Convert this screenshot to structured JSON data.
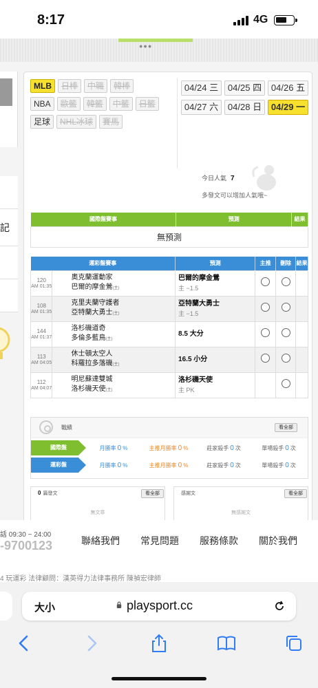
{
  "status": {
    "time": "8:17",
    "network": "4G"
  },
  "sidebar": {
    "record_label": "記錄"
  },
  "sports": {
    "row1": [
      {
        "label": "MLB",
        "state": "active"
      },
      {
        "label": "日棒",
        "state": "dim"
      },
      {
        "label": "中職",
        "state": "dim"
      },
      {
        "label": "韓棒",
        "state": "dim"
      }
    ],
    "row2": [
      {
        "label": "NBA",
        "state": "normal"
      },
      {
        "label": "歐籃",
        "state": "dim"
      },
      {
        "label": "韓籃",
        "state": "dim"
      },
      {
        "label": "中籃",
        "state": "dim"
      },
      {
        "label": "日籃",
        "state": "dim"
      }
    ],
    "row3": [
      {
        "label": "足球",
        "state": "normal"
      },
      {
        "label": "NHL冰球",
        "state": "dim"
      },
      {
        "label": "賽馬",
        "state": "dim"
      }
    ]
  },
  "dates": [
    {
      "label": "04/24 三",
      "active": false
    },
    {
      "label": "04/25 四",
      "active": false
    },
    {
      "label": "04/26 五",
      "active": false
    },
    {
      "label": "04/27 六",
      "active": false
    },
    {
      "label": "04/28 日",
      "active": false
    },
    {
      "label": "04/29 一",
      "active": true
    }
  ],
  "popularity": {
    "label": "今日人氣",
    "value": "7",
    "hint": "多發文可以增加人氣哦~"
  },
  "intl_table": {
    "headers": [
      "國際盤賽事",
      "預測",
      "結果"
    ],
    "empty": "無預測"
  },
  "lottery_table": {
    "headers": [
      "運彩盤賽事",
      "預測",
      "主推",
      "刪除",
      "結果"
    ],
    "rows": [
      {
        "id": "120",
        "time": "AM 01:35",
        "team1": "奧克蘭運動家",
        "team2": "巴爾的摩金鶯",
        "team2_tag": "(主)",
        "pick": "巴爾的摩金鶯",
        "line": "主 −1.5",
        "main": true,
        "delete": true
      },
      {
        "id": "108",
        "time": "AM 01:35",
        "team1": "克里夫蘭守護者",
        "team2": "亞特蘭大勇士",
        "team2_tag": "(主)",
        "pick": "亞特蘭大勇士",
        "line": "主 −1.5",
        "main": true,
        "delete": true
      },
      {
        "id": "144",
        "time": "AM 01:37",
        "team1": "洛杉磯道奇",
        "team2": "多倫多藍鳥",
        "team2_tag": "(主)",
        "pick": "8.5 大分",
        "line": "",
        "main": true,
        "delete": true
      },
      {
        "id": "113",
        "time": "AM 04:05",
        "team1": "休士頓太空人",
        "team2": "科羅拉多落磯",
        "team2_tag": "(主)",
        "pick": "16.5 小分",
        "line": "",
        "main": true,
        "delete": true
      },
      {
        "id": "112",
        "time": "AM 04:07",
        "team1": "明尼蘇達雙城",
        "team2": "洛杉磯天使",
        "team2_tag": "(主)",
        "pick": "洛杉磯天使",
        "line": "主 PK",
        "main": false,
        "delete": true
      }
    ]
  },
  "record": {
    "title": "戰績",
    "view_all": "看全部",
    "rows": [
      {
        "label": "國際盤",
        "color": "green",
        "monthly": "0",
        "main_monthly": "0",
        "banker": "0",
        "single": "0"
      },
      {
        "label": "運彩盤",
        "color": "blue",
        "monthly": "0",
        "main_monthly": "0",
        "banker": "0",
        "single": "0"
      }
    ],
    "labels": {
      "monthly": "月勝率",
      "main_monthly": "主推月勝率",
      "banker": "莊家殺手",
      "single": "單場殺手",
      "pct": "%",
      "times": "次"
    }
  },
  "posts": {
    "count": "0",
    "label": "篇發文",
    "view_all": "看全部",
    "empty": "無文章"
  },
  "thanks": {
    "label": "感謝文",
    "view_all": "看全部",
    "empty": "無感謝文"
  },
  "footer": {
    "hours": "話 09:30 ~ 24:00",
    "phone": "-9700123",
    "links": [
      "聯絡我們",
      "常見問題",
      "服務條款",
      "關於我們"
    ],
    "legal": "4 玩運彩 法律顧問：漢英得力法律事務所 陳禎宏律師"
  },
  "browser": {
    "text_size": "大小",
    "url": "playsport.cc"
  }
}
